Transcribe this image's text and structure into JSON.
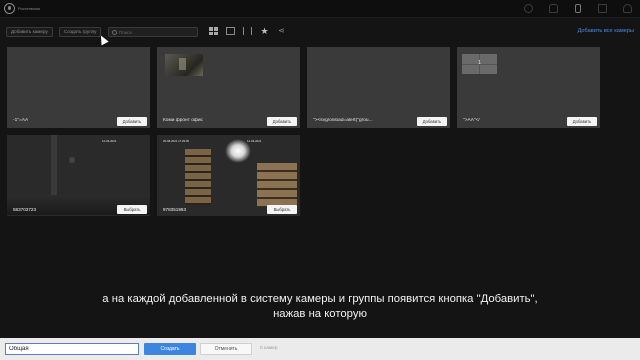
{
  "app": {
    "brand_text": "Ростелеком"
  },
  "header_icons": [
    "gear-icon",
    "bell-icon",
    "camera-icon",
    "folder-icon",
    "user-icon"
  ],
  "toolbar": {
    "add_camera_label": "Добавить камеру",
    "create_group_label": "Создать группу",
    "search_placeholder": "Поиск",
    "view_icons": [
      "grid-view-icon",
      "map-view-icon",
      "sort-icon",
      "star-icon",
      "share-icon"
    ],
    "add_all_label": "Добавить все камеры"
  },
  "cards": [
    {
      "name": "-1\"=AA",
      "button_label": "Добавить",
      "kind": "empty"
    },
    {
      "name": "Коми фронт офис",
      "button_label": "Добавить",
      "kind": "thumb"
    },
    {
      "name": "\"><svg/onload=alert(\"grou...",
      "button_label": "Добавить",
      "kind": "empty"
    },
    {
      "name": "\">AA\"</",
      "button_label": "Добавить",
      "kind": "group",
      "group_count": "1"
    },
    {
      "name": "583703723",
      "button_label": "Выбрать",
      "kind": "video",
      "timestamp": "12-03-2021"
    },
    {
      "name": "978351963",
      "button_label": "Выбрать",
      "kind": "video",
      "timestamp": "25-08-2021 17:29:05",
      "timestamp_right": "12-03-2021"
    }
  ],
  "subtitles": {
    "line1": "а на каждой добавленной в систему камеры и группы появится кнопка \"Добавить\",",
    "line2": "нажав на которую"
  },
  "bottom_bar": {
    "group_name_value": "Общая",
    "create_label": "Создать",
    "cancel_label": "Отменить",
    "count_label": "0 камер"
  },
  "colors": {
    "accent": "#3d86e0",
    "link": "#4a8fe2",
    "background": "#141414",
    "card": "#3a3a3a"
  }
}
